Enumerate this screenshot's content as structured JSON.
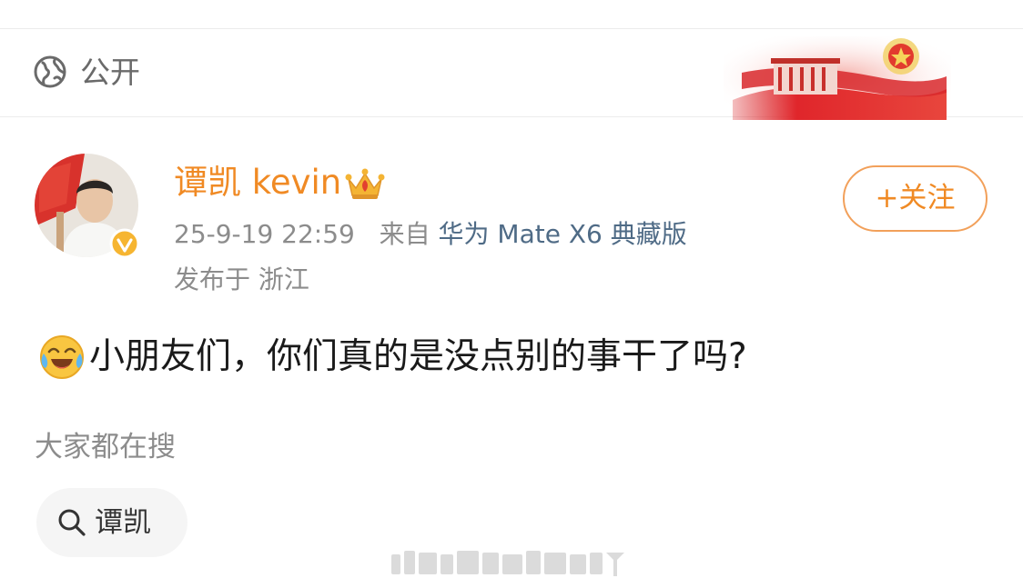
{
  "visibility": {
    "label": "公开",
    "icon": "globe-icon"
  },
  "post": {
    "author": {
      "name": "谭凯 kevin",
      "verified": true,
      "badge_icon": "crown-icon"
    },
    "timestamp": "25-9-19 22:59",
    "source_prefix": "来自",
    "device": "华为 Mate X6 典藏版",
    "location": "发布于 浙江",
    "text": "小朋友们，你们真的是没点别的事干了吗?",
    "emoji": "laugh-cry-icon"
  },
  "follow_button": {
    "label": "+关注"
  },
  "hot_search": {
    "title": "大家都在搜",
    "items": [
      {
        "label": "谭凯",
        "icon": "search-icon"
      }
    ]
  },
  "colors": {
    "accent": "#f08a24",
    "link": "#4f6b86",
    "muted_text": "#8c8c8c",
    "body_text": "#1a1a1a",
    "chip_bg": "#f5f5f5"
  }
}
